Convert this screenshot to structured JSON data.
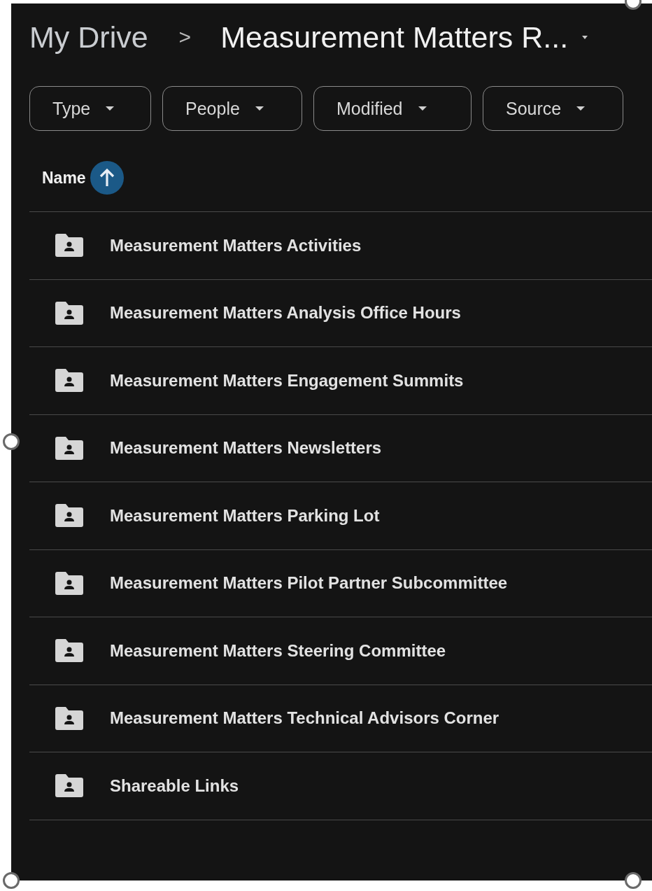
{
  "breadcrumb": {
    "items": [
      {
        "label": "My Drive",
        "current": false
      },
      {
        "label": "Measurement Matters R...",
        "current": true
      }
    ],
    "separator": ">"
  },
  "filters": [
    {
      "label": "Type"
    },
    {
      "label": "People"
    },
    {
      "label": "Modified"
    },
    {
      "label": "Source"
    }
  ],
  "list_header": {
    "label": "Name"
  },
  "files": [
    {
      "name": "Measurement Matters Activities"
    },
    {
      "name": "Measurement Matters Analysis Office Hours"
    },
    {
      "name": "Measurement Matters Engagement Summits"
    },
    {
      "name": "Measurement Matters Newsletters"
    },
    {
      "name": "Measurement Matters Parking Lot"
    },
    {
      "name": "Measurement Matters Pilot Partner Subcommittee"
    },
    {
      "name": "Measurement Matters Steering Committee"
    },
    {
      "name": "Measurement Matters Technical Advisors Corner"
    },
    {
      "name": "Shareable Links"
    }
  ]
}
